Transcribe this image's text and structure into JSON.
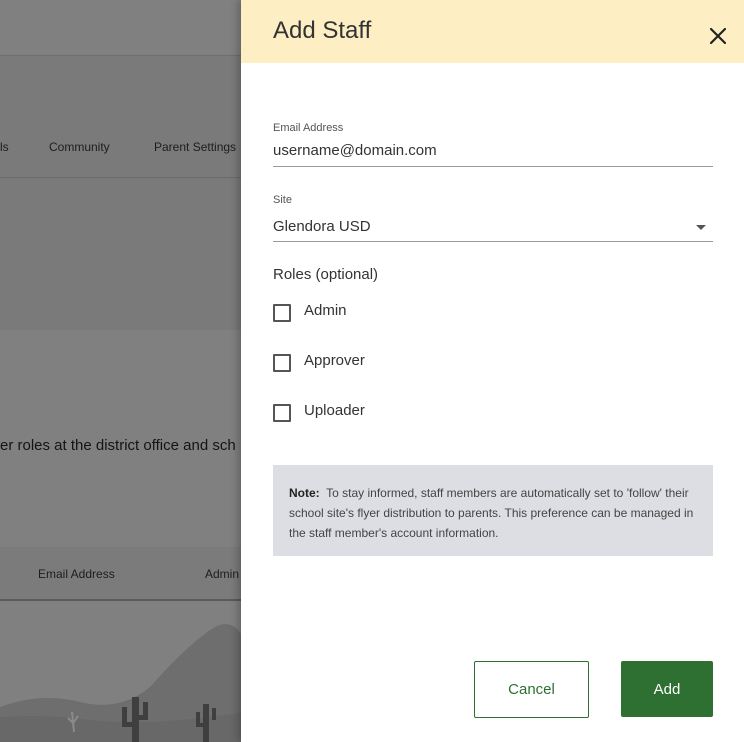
{
  "background": {
    "tabs": [
      "ls",
      "Community",
      "Parent Settings"
    ],
    "description": "er roles at the district office and sch",
    "table_headers": [
      "Email Address",
      "Admin"
    ]
  },
  "drawer": {
    "title": "Add Staff",
    "close_icon": "close-icon",
    "email": {
      "label": "Email Address",
      "value": "username@domain.com"
    },
    "site": {
      "label": "Site",
      "value": "Glendora USD"
    },
    "roles": {
      "label": "Roles (optional)",
      "options": [
        {
          "label": "Admin",
          "checked": false
        },
        {
          "label": "Approver",
          "checked": false
        },
        {
          "label": "Uploader",
          "checked": false
        }
      ]
    },
    "note": {
      "prefix": "Note:",
      "text": "To stay informed, staff members are automatically set to 'follow' their school site's flyer distribution to parents. This preference can be managed in the staff member's account information."
    },
    "cancel_label": "Cancel",
    "add_label": "Add"
  },
  "colors": {
    "header": "#fdeec4",
    "primary": "#2e7032",
    "note_bg": "#dcdee3",
    "overlay": "#808080"
  }
}
